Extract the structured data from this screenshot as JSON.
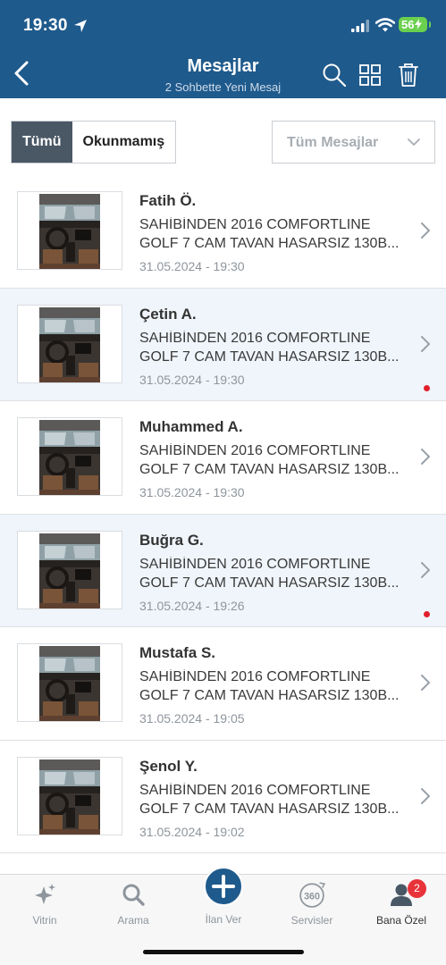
{
  "status_bar": {
    "time": "19:30",
    "battery": "56"
  },
  "header": {
    "title": "Mesajlar",
    "subtitle": "2 Sohbette Yeni Mesaj"
  },
  "filters": {
    "tab_all": "Tümü",
    "tab_unread": "Okunmamış",
    "dropdown_value": "Tüm Mesajlar"
  },
  "messages": [
    {
      "sender": "Fatih Ö.",
      "line1": "SAHİBİNDEN 2016 COMFORTLINE",
      "line2": "GOLF 7 CAM TAVAN HASARSIZ 130B...",
      "date": "31.05.2024 - 19:30",
      "unread": false
    },
    {
      "sender": "Çetin A.",
      "line1": "SAHİBİNDEN 2016 COMFORTLINE",
      "line2": "GOLF 7 CAM TAVAN HASARSIZ 130B...",
      "date": "31.05.2024 - 19:30",
      "unread": true
    },
    {
      "sender": "Muhammed A.",
      "line1": "SAHİBİNDEN 2016 COMFORTLINE",
      "line2": "GOLF 7 CAM TAVAN HASARSIZ 130B...",
      "date": "31.05.2024 - 19:30",
      "unread": false
    },
    {
      "sender": "Buğra G.",
      "line1": "SAHİBİNDEN 2016 COMFORTLINE",
      "line2": "GOLF 7 CAM TAVAN HASARSIZ 130B...",
      "date": "31.05.2024 - 19:26",
      "unread": true
    },
    {
      "sender": "Mustafa S.",
      "line1": "SAHİBİNDEN 2016 COMFORTLINE",
      "line2": "GOLF 7 CAM TAVAN HASARSIZ 130B...",
      "date": "31.05.2024 - 19:05",
      "unread": false
    },
    {
      "sender": "Şenol Y.",
      "line1": "SAHİBİNDEN 2016 COMFORTLINE",
      "line2": "GOLF 7 CAM TAVAN HASARSIZ 130B...",
      "date": "31.05.2024 - 19:02",
      "unread": false
    }
  ],
  "tabbar": {
    "vitrin": "Vitrin",
    "arama": "Arama",
    "ilan_ver": "İlan Ver",
    "servisler": "Servisler",
    "servisler_icon_text": "360",
    "bana_ozel": "Bana Özel",
    "badge_count": "2"
  },
  "colors": {
    "header_bg": "#1f5a8c",
    "unread_row_bg": "#f0f5fb",
    "unread_dot": "#e0202a",
    "badge": "#e8333a",
    "battery": "#6ad04e"
  }
}
